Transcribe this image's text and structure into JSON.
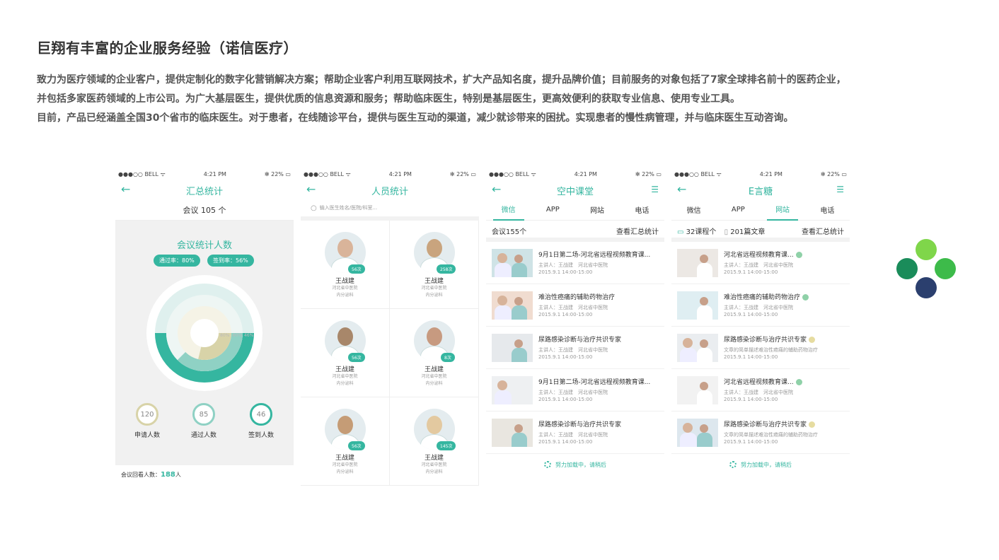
{
  "page": {
    "title": "巨翔有丰富的企业服务经验（诺信医疗）",
    "desc": [
      "致力为医疗领域的企业客户，提供定制化的数字化营销解决方案；帮助企业客户利用互联网技术，扩大产品知名度，提升品牌价值；目前服务的对象包括了7家全球排名前十的医药企业，",
      "并包括多家医药领域的上市公司。为广大基层医生，提供优质的信息资源和服务；帮助临床医生，特别是基层医生，更高效便利的获取专业信息、使用专业工具。",
      "目前，产品已经涵盖全国30个省市的临床医生。对于患者，在线随诊平台，提供与医生互动的渠道，减少就诊带来的困扰。实现患者的慢性病管理，并与临床医生互动咨询。"
    ]
  },
  "status": {
    "carrier": "●●●○○ BELL ᯤ",
    "time": "4:21 PM",
    "battery": "✻ 22% ▭"
  },
  "icons": {
    "back": "arrow-left-icon",
    "menu": "menu-icon",
    "search": "search-icon",
    "spinner": "spinner-icon"
  },
  "colors": {
    "accent": "#35b6a0",
    "ring_light": "#dff0ee",
    "ring_mid": "#8fd1c4",
    "ring_inner": "#d8d3a8"
  },
  "phone1": {
    "title": "汇总统计",
    "subtitle": "会议 105 个",
    "panel_title": "会议统计人数",
    "pass_rate": "通过率：80%",
    "sign_rate": "签到率：56%",
    "ring_labels": [
      "80%",
      "60%",
      "46%"
    ],
    "ring_fractions": [
      0.8,
      0.6,
      0.46
    ],
    "stats": [
      {
        "value": "120",
        "label": "申请人数",
        "color": "#d8d3a8"
      },
      {
        "value": "85",
        "label": "通过人数",
        "color": "#8fd1c4"
      },
      {
        "value": "46",
        "label": "签到人数",
        "color": "#35b6a0"
      }
    ],
    "footer_label": "会议回看人数：",
    "footer_value": "188",
    "footer_unit": "人"
  },
  "phone2": {
    "title": "人员统计",
    "search_placeholder": "输入医生姓名/医院/科室...",
    "doctors": [
      {
        "badge": "56次",
        "name": "王战建",
        "hospital": "河北省中医院",
        "dept": "内分泌科"
      },
      {
        "badge": "258次",
        "name": "王战建",
        "hospital": "河北省中医院",
        "dept": "内分泌科"
      },
      {
        "badge": "56次",
        "name": "王战建",
        "hospital": "河北省中医院",
        "dept": "内分泌科"
      },
      {
        "badge": "8次",
        "name": "王战建",
        "hospital": "河北省中医院",
        "dept": "内分泌科"
      },
      {
        "badge": "56次",
        "name": "王战建",
        "hospital": "河北省中医院",
        "dept": "内分泌科"
      },
      {
        "badge": "145次",
        "name": "王战建",
        "hospital": "河北省中医院",
        "dept": "内分泌科"
      }
    ]
  },
  "phone3": {
    "title": "空中课堂",
    "tabs": [
      "微信",
      "APP",
      "网站",
      "电话"
    ],
    "active_tab": 0,
    "info_left": "会议155个",
    "info_right": "查看汇总统计",
    "items": [
      {
        "title": "9月1日第二场-河北省远程视频教育课...",
        "speaker": "主讲人：王战建　河北省中医院",
        "time": "2015.9.1 14:00-15:00"
      },
      {
        "title": "难治性癌痛的辅助药物治疗",
        "speaker": "主讲人：王战建　河北省中医院",
        "time": "2015.9.1 14:00-15:00"
      },
      {
        "title": "尿路感染诊断与治疗共识专家",
        "speaker": "主讲人：王战建　河北省中医院",
        "time": "2015.9.1 14:00-15:00"
      },
      {
        "title": "9月1日第二场-河北省远程视频教育课...",
        "speaker": "主讲人：王战建　河北省中医院",
        "time": "2015.9.1 14:00-15:00"
      },
      {
        "title": "尿路感染诊断与治疗共识专家",
        "speaker": "主讲人：王战建　河北省中医院",
        "time": "2015.9.1 14:00-15:00"
      }
    ],
    "loading": "努力加载中，请稍后"
  },
  "phone4": {
    "title": "E言糖",
    "tabs": [
      "微信",
      "APP",
      "网站",
      "电话"
    ],
    "active_tab": 2,
    "courses": "32课程个",
    "articles": "201篇文章",
    "info_right": "查看汇总统计",
    "items": [
      {
        "title": "河北省远程视频教育课...",
        "line1": "主讲人：王战建　河北省中医院",
        "line2": "2015.9.1 14:00-15:00",
        "dot": "#8fd1a8"
      },
      {
        "title": "难治性癌痛的辅助药物治疗",
        "line1": "主讲人：王战建　河北省中医院",
        "line2": "2015.9.1 14:00-15:00",
        "dot": "#8fd1a8"
      },
      {
        "title": "尿路感染诊断与治疗共识专家",
        "line1": "文章的简单描述难治性癌痛的辅助药物治疗",
        "line2": "2015.9.1 14:00-15:00",
        "dot": "#e6dca0"
      },
      {
        "title": "河北省远程视频教育课...",
        "line1": "主讲人：王战建　河北省中医院",
        "line2": "2015.9.1 14:00-15:00",
        "dot": "#8fd1a8"
      },
      {
        "title": "尿路感染诊断与治疗共识专家",
        "line1": "文章的简单描述难治性癌痛的辅助药物治疗",
        "line2": "2015.9.1 14:00-15:00",
        "dot": "#e6dca0"
      }
    ],
    "loading": "努力加载中，请稍后"
  }
}
